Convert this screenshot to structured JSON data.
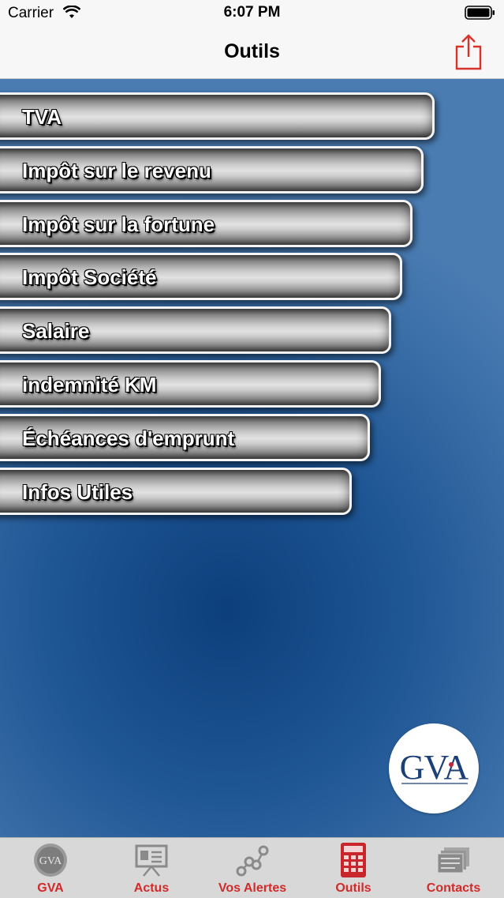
{
  "status_bar": {
    "carrier": "Carrier",
    "time": "6:07 PM"
  },
  "nav": {
    "title": "Outils",
    "share_icon": "share-icon",
    "accent_color": "#d9322b"
  },
  "menu": {
    "items": [
      {
        "label": "TVA"
      },
      {
        "label": "Impôt sur le revenu"
      },
      {
        "label": "Impôt sur la fortune"
      },
      {
        "label": "Impôt Société"
      },
      {
        "label": "Salaire"
      },
      {
        "label": "indemnité KM"
      },
      {
        "label": "Échéances d'emprunt"
      },
      {
        "label": "Infos Utiles"
      }
    ]
  },
  "logo": {
    "text": "GVA"
  },
  "tabbar": {
    "selected": "Outils",
    "label_color": "#d02a2a",
    "tabs": [
      {
        "label": "GVA",
        "icon": "gva-logo-icon"
      },
      {
        "label": "Actus",
        "icon": "presentation-board-icon"
      },
      {
        "label": "Vos Alertes",
        "icon": "network-nodes-icon"
      },
      {
        "label": "Outils",
        "icon": "calculator-icon"
      },
      {
        "label": "Contacts",
        "icon": "address-cards-icon"
      }
    ]
  }
}
